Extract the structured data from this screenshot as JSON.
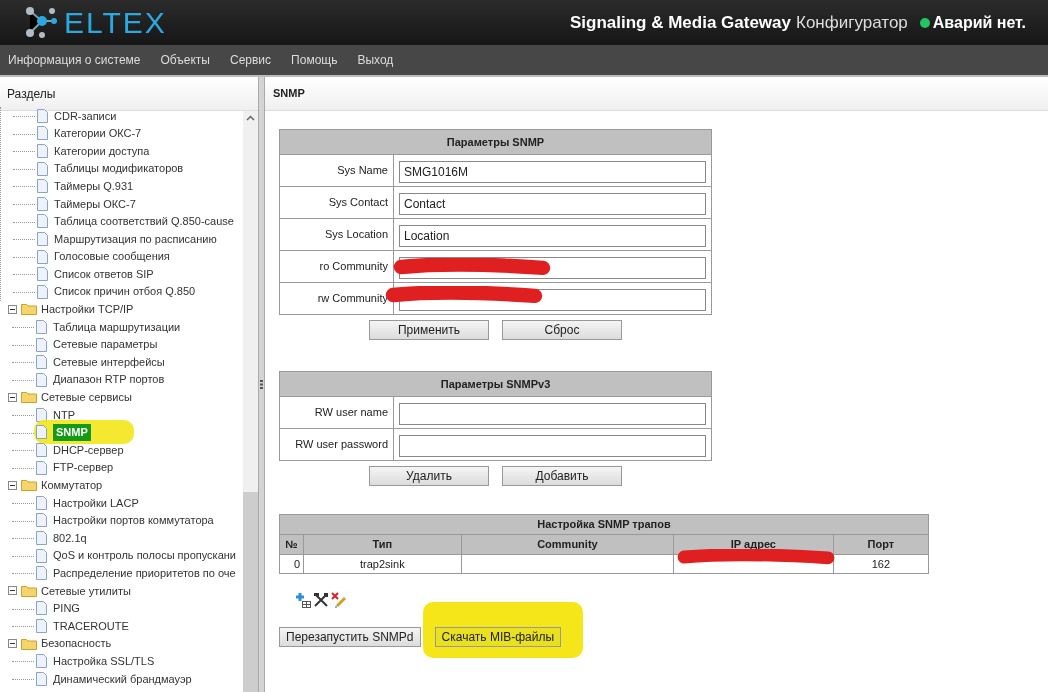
{
  "header": {
    "logo": "ELTEX",
    "product": "Signaling & Media Gateway",
    "subtitle": "Конфигуратор",
    "alarm": {
      "text": "Аварий нет.",
      "color": "#22c55e"
    }
  },
  "menu": [
    "Информация о системе",
    "Объекты",
    "Сервис",
    "Помощь",
    "Выход"
  ],
  "sidebar": {
    "title": "Разделы",
    "tree": [
      {
        "children": [
          {
            "label": "CDR-записи",
            "selected": false
          },
          {
            "label": "Категории ОКС-7",
            "selected": false
          },
          {
            "label": "Категории доступа",
            "selected": false
          },
          {
            "label": "Таблицы модификаторов",
            "selected": false
          },
          {
            "label": "Таймеры Q.931",
            "selected": false
          },
          {
            "label": "Таймеры ОКС-7",
            "selected": false
          },
          {
            "label": "Таблица соответствий Q.850-cause",
            "selected": false
          },
          {
            "label": "Маршрутизация по расписанию",
            "selected": false
          },
          {
            "label": "Голосовые сообщения",
            "selected": false
          },
          {
            "label": "Список ответов SIP",
            "selected": false
          },
          {
            "label": "Список причин отбоя Q.850",
            "selected": false
          }
        ]
      },
      {
        "label": "Настройки TCP/IP",
        "expanded": true,
        "children": [
          {
            "label": "Таблица маршрутизации",
            "selected": false
          },
          {
            "label": "Сетевые параметры",
            "selected": false
          },
          {
            "label": "Сетевые интерфейсы",
            "selected": false
          },
          {
            "label": "Диапазон RTP портов",
            "selected": false
          }
        ]
      },
      {
        "label": "Сетевые сервисы",
        "expanded": true,
        "children": [
          {
            "label": "NTP",
            "selected": false
          },
          {
            "label": "SNMP",
            "selected": true
          },
          {
            "label": "DHCP-сервер",
            "selected": false
          },
          {
            "label": "FTP-сервер",
            "selected": false
          }
        ]
      },
      {
        "label": "Коммутатор",
        "expanded": true,
        "children": [
          {
            "label": "Настройки LACP",
            "selected": false
          },
          {
            "label": "Настройки портов коммутатора",
            "selected": false
          },
          {
            "label": "802.1q",
            "selected": false
          },
          {
            "label": "QoS и контроль полосы пропускани",
            "selected": false
          },
          {
            "label": "Распределение приоритетов по оче",
            "selected": false
          }
        ]
      },
      {
        "label": "Сетевые утилиты",
        "expanded": true,
        "children": [
          {
            "label": "PING",
            "selected": false
          },
          {
            "label": "TRACEROUTE",
            "selected": false
          }
        ]
      },
      {
        "label": "Безопасность",
        "expanded": true,
        "children": [
          {
            "label": "Настройка SSL/TLS",
            "selected": false
          },
          {
            "label": "Динамический брандмауэр",
            "selected": false
          }
        ]
      }
    ]
  },
  "page_title": "SNMP",
  "snmp": {
    "title": "Параметры SNMP",
    "fields": [
      {
        "label": "Sys Name",
        "value": "SMG1016M"
      },
      {
        "label": "Sys Contact",
        "value": "Contact"
      },
      {
        "label": "Sys Location",
        "value": "Location"
      },
      {
        "label": "ro Community",
        "redacted": true
      },
      {
        "label": "rw Community",
        "redacted": true
      }
    ],
    "buttons": [
      "Применить",
      "Сброс"
    ]
  },
  "snmpv3": {
    "title": "Параметры SNMPv3",
    "fields": [
      {
        "label": "RW user name"
      },
      {
        "label": "RW user password"
      }
    ],
    "buttons": [
      "Удалить",
      "Добавить"
    ]
  },
  "traps": {
    "title": "Настройка SNMP трапов",
    "columns": [
      "№",
      "Тип",
      "Community",
      "IP адрес",
      "Порт"
    ],
    "rows": [
      {
        "cells": [
          "0",
          "trap2sink",
          "",
          "",
          "162"
        ],
        "redacted_ip": true
      }
    ]
  },
  "actions": [
    {
      "label": "Перезапустить SNMPd",
      "highlighted": false
    },
    {
      "label": "Скачать MIB-файлы",
      "highlighted": true
    }
  ]
}
